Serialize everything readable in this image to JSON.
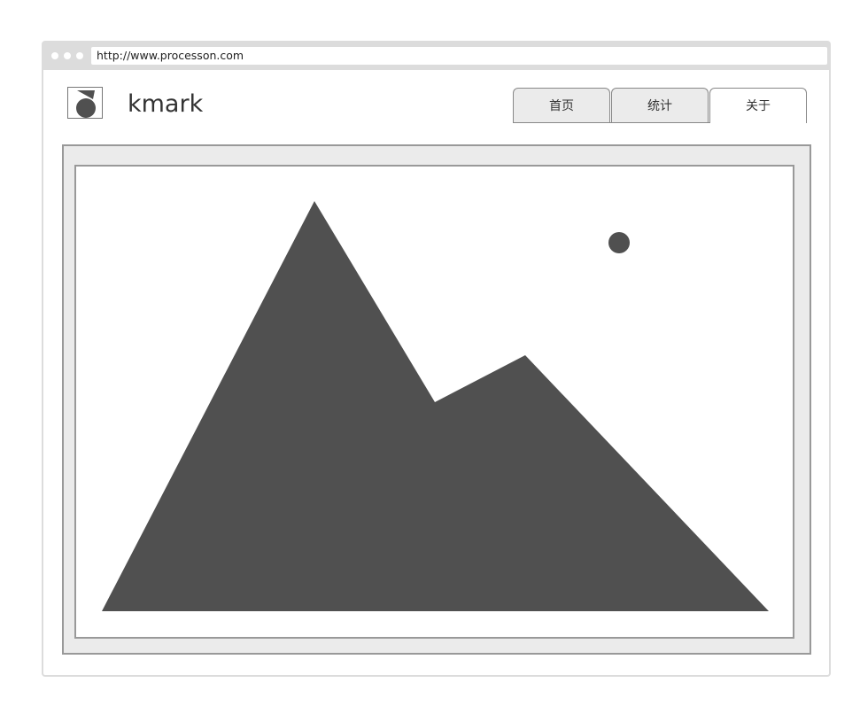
{
  "browser": {
    "url": "http://www.processon.com"
  },
  "header": {
    "brand_name": "kmark",
    "logo_icon": "logo-icon"
  },
  "nav": {
    "tabs": [
      {
        "label": "首页",
        "active": false
      },
      {
        "label": "统计",
        "active": false
      },
      {
        "label": "关于",
        "active": true
      }
    ]
  },
  "main": {
    "image_icon": "image-placeholder-icon"
  },
  "colors": {
    "chrome": "#dcdcdc",
    "frame_fill": "#ebebeb",
    "border": "#999999",
    "mountain": "#505050"
  }
}
